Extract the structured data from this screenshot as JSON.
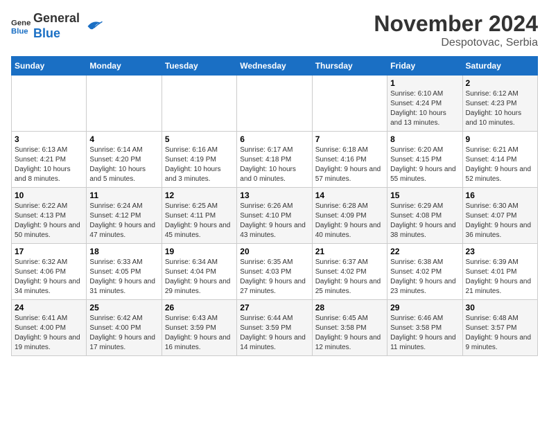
{
  "header": {
    "logo_general": "General",
    "logo_blue": "Blue",
    "title": "November 2024",
    "subtitle": "Despotovac, Serbia"
  },
  "weekdays": [
    "Sunday",
    "Monday",
    "Tuesday",
    "Wednesday",
    "Thursday",
    "Friday",
    "Saturday"
  ],
  "weeks": [
    [
      {
        "day": "",
        "info": ""
      },
      {
        "day": "",
        "info": ""
      },
      {
        "day": "",
        "info": ""
      },
      {
        "day": "",
        "info": ""
      },
      {
        "day": "",
        "info": ""
      },
      {
        "day": "1",
        "info": "Sunrise: 6:10 AM\nSunset: 4:24 PM\nDaylight: 10 hours and 13 minutes."
      },
      {
        "day": "2",
        "info": "Sunrise: 6:12 AM\nSunset: 4:23 PM\nDaylight: 10 hours and 10 minutes."
      }
    ],
    [
      {
        "day": "3",
        "info": "Sunrise: 6:13 AM\nSunset: 4:21 PM\nDaylight: 10 hours and 8 minutes."
      },
      {
        "day": "4",
        "info": "Sunrise: 6:14 AM\nSunset: 4:20 PM\nDaylight: 10 hours and 5 minutes."
      },
      {
        "day": "5",
        "info": "Sunrise: 6:16 AM\nSunset: 4:19 PM\nDaylight: 10 hours and 3 minutes."
      },
      {
        "day": "6",
        "info": "Sunrise: 6:17 AM\nSunset: 4:18 PM\nDaylight: 10 hours and 0 minutes."
      },
      {
        "day": "7",
        "info": "Sunrise: 6:18 AM\nSunset: 4:16 PM\nDaylight: 9 hours and 57 minutes."
      },
      {
        "day": "8",
        "info": "Sunrise: 6:20 AM\nSunset: 4:15 PM\nDaylight: 9 hours and 55 minutes."
      },
      {
        "day": "9",
        "info": "Sunrise: 6:21 AM\nSunset: 4:14 PM\nDaylight: 9 hours and 52 minutes."
      }
    ],
    [
      {
        "day": "10",
        "info": "Sunrise: 6:22 AM\nSunset: 4:13 PM\nDaylight: 9 hours and 50 minutes."
      },
      {
        "day": "11",
        "info": "Sunrise: 6:24 AM\nSunset: 4:12 PM\nDaylight: 9 hours and 47 minutes."
      },
      {
        "day": "12",
        "info": "Sunrise: 6:25 AM\nSunset: 4:11 PM\nDaylight: 9 hours and 45 minutes."
      },
      {
        "day": "13",
        "info": "Sunrise: 6:26 AM\nSunset: 4:10 PM\nDaylight: 9 hours and 43 minutes."
      },
      {
        "day": "14",
        "info": "Sunrise: 6:28 AM\nSunset: 4:09 PM\nDaylight: 9 hours and 40 minutes."
      },
      {
        "day": "15",
        "info": "Sunrise: 6:29 AM\nSunset: 4:08 PM\nDaylight: 9 hours and 38 minutes."
      },
      {
        "day": "16",
        "info": "Sunrise: 6:30 AM\nSunset: 4:07 PM\nDaylight: 9 hours and 36 minutes."
      }
    ],
    [
      {
        "day": "17",
        "info": "Sunrise: 6:32 AM\nSunset: 4:06 PM\nDaylight: 9 hours and 34 minutes."
      },
      {
        "day": "18",
        "info": "Sunrise: 6:33 AM\nSunset: 4:05 PM\nDaylight: 9 hours and 31 minutes."
      },
      {
        "day": "19",
        "info": "Sunrise: 6:34 AM\nSunset: 4:04 PM\nDaylight: 9 hours and 29 minutes."
      },
      {
        "day": "20",
        "info": "Sunrise: 6:35 AM\nSunset: 4:03 PM\nDaylight: 9 hours and 27 minutes."
      },
      {
        "day": "21",
        "info": "Sunrise: 6:37 AM\nSunset: 4:02 PM\nDaylight: 9 hours and 25 minutes."
      },
      {
        "day": "22",
        "info": "Sunrise: 6:38 AM\nSunset: 4:02 PM\nDaylight: 9 hours and 23 minutes."
      },
      {
        "day": "23",
        "info": "Sunrise: 6:39 AM\nSunset: 4:01 PM\nDaylight: 9 hours and 21 minutes."
      }
    ],
    [
      {
        "day": "24",
        "info": "Sunrise: 6:41 AM\nSunset: 4:00 PM\nDaylight: 9 hours and 19 minutes."
      },
      {
        "day": "25",
        "info": "Sunrise: 6:42 AM\nSunset: 4:00 PM\nDaylight: 9 hours and 17 minutes."
      },
      {
        "day": "26",
        "info": "Sunrise: 6:43 AM\nSunset: 3:59 PM\nDaylight: 9 hours and 16 minutes."
      },
      {
        "day": "27",
        "info": "Sunrise: 6:44 AM\nSunset: 3:59 PM\nDaylight: 9 hours and 14 minutes."
      },
      {
        "day": "28",
        "info": "Sunrise: 6:45 AM\nSunset: 3:58 PM\nDaylight: 9 hours and 12 minutes."
      },
      {
        "day": "29",
        "info": "Sunrise: 6:46 AM\nSunset: 3:58 PM\nDaylight: 9 hours and 11 minutes."
      },
      {
        "day": "30",
        "info": "Sunrise: 6:48 AM\nSunset: 3:57 PM\nDaylight: 9 hours and 9 minutes."
      }
    ]
  ]
}
